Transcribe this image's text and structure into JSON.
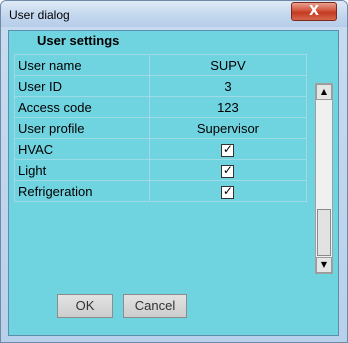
{
  "window": {
    "title": "User dialog",
    "close_symbol": "X"
  },
  "section_title": "User settings",
  "rows": [
    {
      "label": "User name",
      "value": "SUPV"
    },
    {
      "label": "User ID",
      "value": "3"
    },
    {
      "label": "Access code",
      "value": "123"
    },
    {
      "label": "User profile",
      "value": "Supervisor"
    },
    {
      "label": "HVAC",
      "checked": true
    },
    {
      "label": "Light",
      "checked": true
    },
    {
      "label": "Refrigeration",
      "checked": true
    }
  ],
  "checkmark": "✓",
  "buttons": {
    "ok": "OK",
    "cancel": "Cancel"
  },
  "scrollbar": {
    "up_arrow": "▲",
    "down_arrow": "▼"
  },
  "colors": {
    "content_background": "#6fd3e0",
    "close_button": "#c33a22"
  }
}
